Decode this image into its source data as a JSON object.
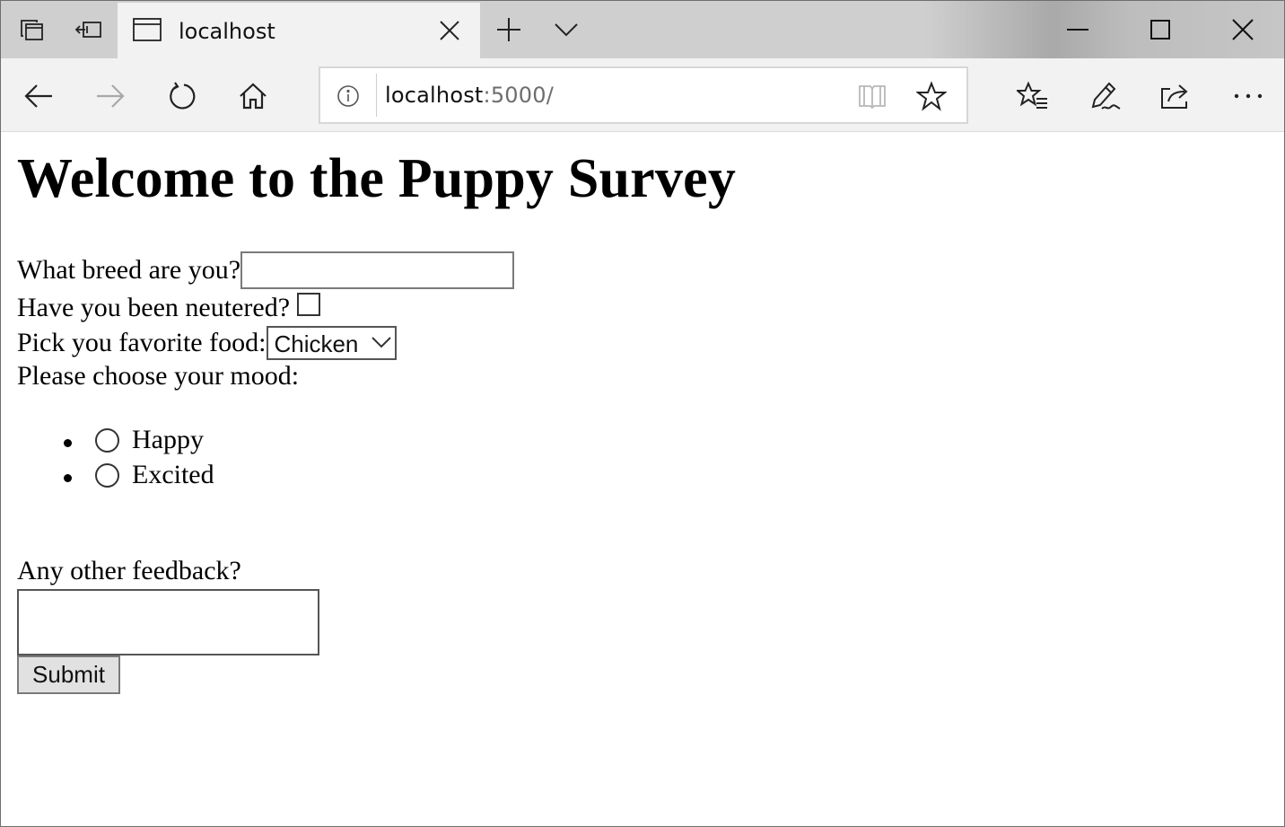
{
  "browser": {
    "tab": {
      "title": "localhost"
    },
    "address": {
      "host": "localhost",
      "port_path": ":5000/"
    },
    "icons": [
      "tab-preview-icon",
      "set-aside-tabs-icon",
      "page-icon",
      "close-icon",
      "new-tab-icon",
      "chevron-down-icon",
      "minimize-icon",
      "maximize-icon",
      "window-close-icon",
      "back-icon",
      "forward-icon",
      "refresh-icon",
      "home-icon",
      "info-icon",
      "reading-view-icon",
      "favorite-star-icon",
      "favorites-hub-icon",
      "notes-pen-icon",
      "share-icon",
      "more-icon"
    ]
  },
  "page": {
    "heading": "Welcome to the Puppy Survey",
    "breed_label": "What breed are you?",
    "breed_value": "",
    "neutered_label": "Have you been neutered?",
    "neutered_checked": false,
    "food_label": "Pick you favorite food:",
    "food_selected": "Chicken",
    "mood_label": "Please choose your mood:",
    "moods": [
      {
        "label": "Happy",
        "selected": false
      },
      {
        "label": "Excited",
        "selected": false
      }
    ],
    "feedback_label": "Any other feedback?",
    "feedback_value": "",
    "submit_label": "Submit"
  }
}
